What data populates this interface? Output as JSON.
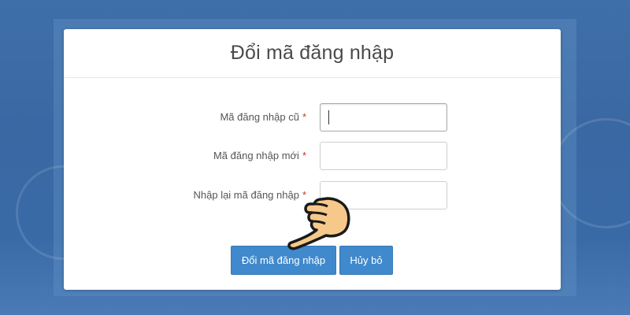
{
  "dialog": {
    "title": "Đổi mã đăng nhập",
    "fields": [
      {
        "label": "Mã đăng nhập cũ",
        "required_mark": "*",
        "value": ""
      },
      {
        "label": "Mã đăng nhập mới",
        "required_mark": "*",
        "value": ""
      },
      {
        "label": "Nhập lại mã đăng nhập",
        "required_mark": "*",
        "value": ""
      }
    ],
    "submit_label": "Đổi mã đăng nhập",
    "cancel_label": "Hủy bỏ"
  },
  "colors": {
    "background": "#3f6fa8",
    "button": "#3f89cc",
    "required": "#c0392b",
    "hand_fill": "#f6c98a"
  },
  "icons": {
    "pointer": "pointing-hand-icon"
  }
}
